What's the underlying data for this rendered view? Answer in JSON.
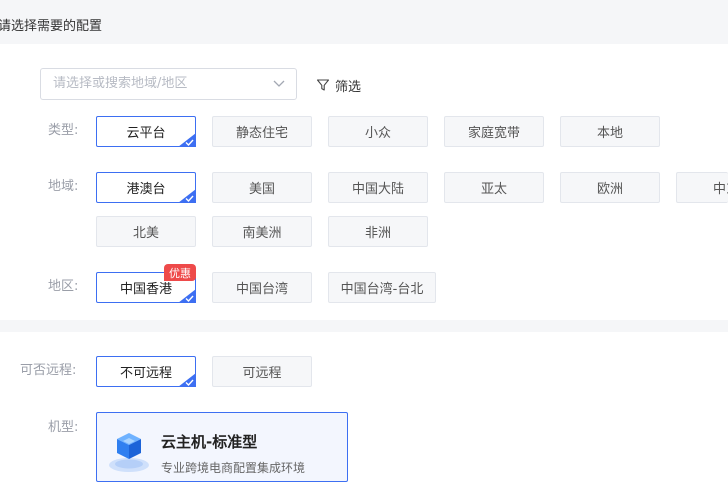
{
  "header": {
    "title": "请选择需要的配置"
  },
  "search": {
    "placeholder": "请选择或搜索地域/地区",
    "value": ""
  },
  "filter": {
    "label": "筛选"
  },
  "type_row": {
    "label": "类型:",
    "options": [
      "云平台",
      "静态住宅",
      "小众",
      "家庭宽带",
      "本地"
    ],
    "selected": "云平台"
  },
  "region_row": {
    "label": "地域:",
    "options": [
      "港澳台",
      "美国",
      "中国大陆",
      "亚太",
      "欧洲",
      "中东",
      "北美",
      "南美洲",
      "非洲"
    ],
    "selected": "港澳台"
  },
  "area_row": {
    "label": "地区:",
    "options": [
      "中国香港",
      "中国台湾",
      "中国台湾-台北"
    ],
    "selected": "中国香港",
    "badge": "优惠"
  },
  "remote_row": {
    "label": "可否远程:",
    "options": [
      "不可远程",
      "可远程"
    ],
    "selected": "不可远程"
  },
  "model_row": {
    "label": "机型:",
    "card": {
      "name": "云主机-标准型",
      "desc": "专业跨境电商配置集成环境"
    }
  },
  "colors": {
    "accent": "#3d6ff2",
    "badge": "#ee4a4a",
    "option_bg": "#f6f7f9",
    "page_bg": "#f5f6f8"
  }
}
